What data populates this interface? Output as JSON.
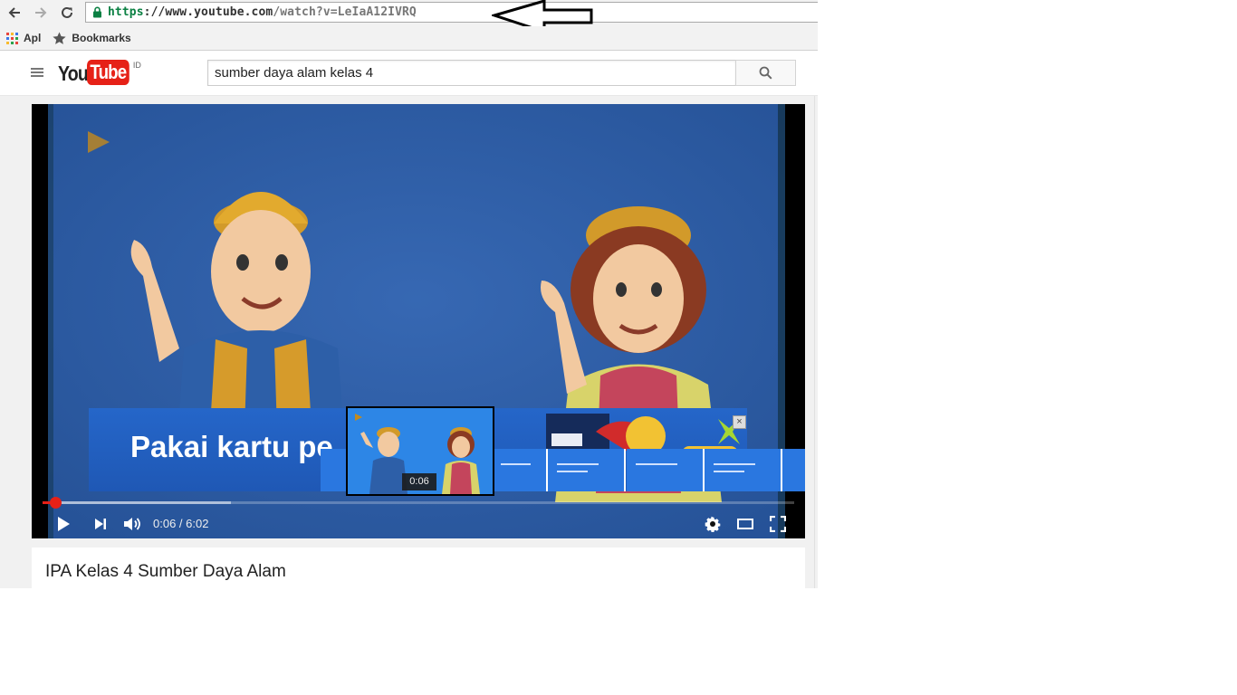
{
  "browser": {
    "url": {
      "scheme": "https",
      "separator": "://",
      "host": "www.youtube.com",
      "path": "/watch?v=LeIaA12IVRQ"
    },
    "icons": {
      "back": "arrow-left-icon",
      "forward": "arrow-right-icon",
      "reload": "reload-icon",
      "secure": "lock-icon"
    },
    "bookmarks": [
      {
        "label": "Apl",
        "icon": "apps-grid-icon"
      },
      {
        "label": "Bookmarks",
        "icon": "star-icon"
      }
    ],
    "annotation_arrow": "arrow-left-icon"
  },
  "youtube": {
    "logo": {
      "you": "You",
      "tube": "Tube",
      "region": "ID"
    },
    "search": {
      "query": "sumber daya alam kelas 4"
    },
    "colors": {
      "brand_red": "#e62117",
      "scheme_green": "#0b8043"
    }
  },
  "player": {
    "ad": {
      "text": "Pakai kartu pe",
      "close": "×"
    },
    "hover_preview_time": "0:06",
    "current_time": "0:06",
    "time_separator": " / ",
    "duration": "6:02",
    "progress": {
      "played_fraction": 0.0166,
      "loaded_fraction": 0.25
    }
  },
  "video": {
    "title": "IPA Kelas 4 Sumber Daya Alam"
  }
}
